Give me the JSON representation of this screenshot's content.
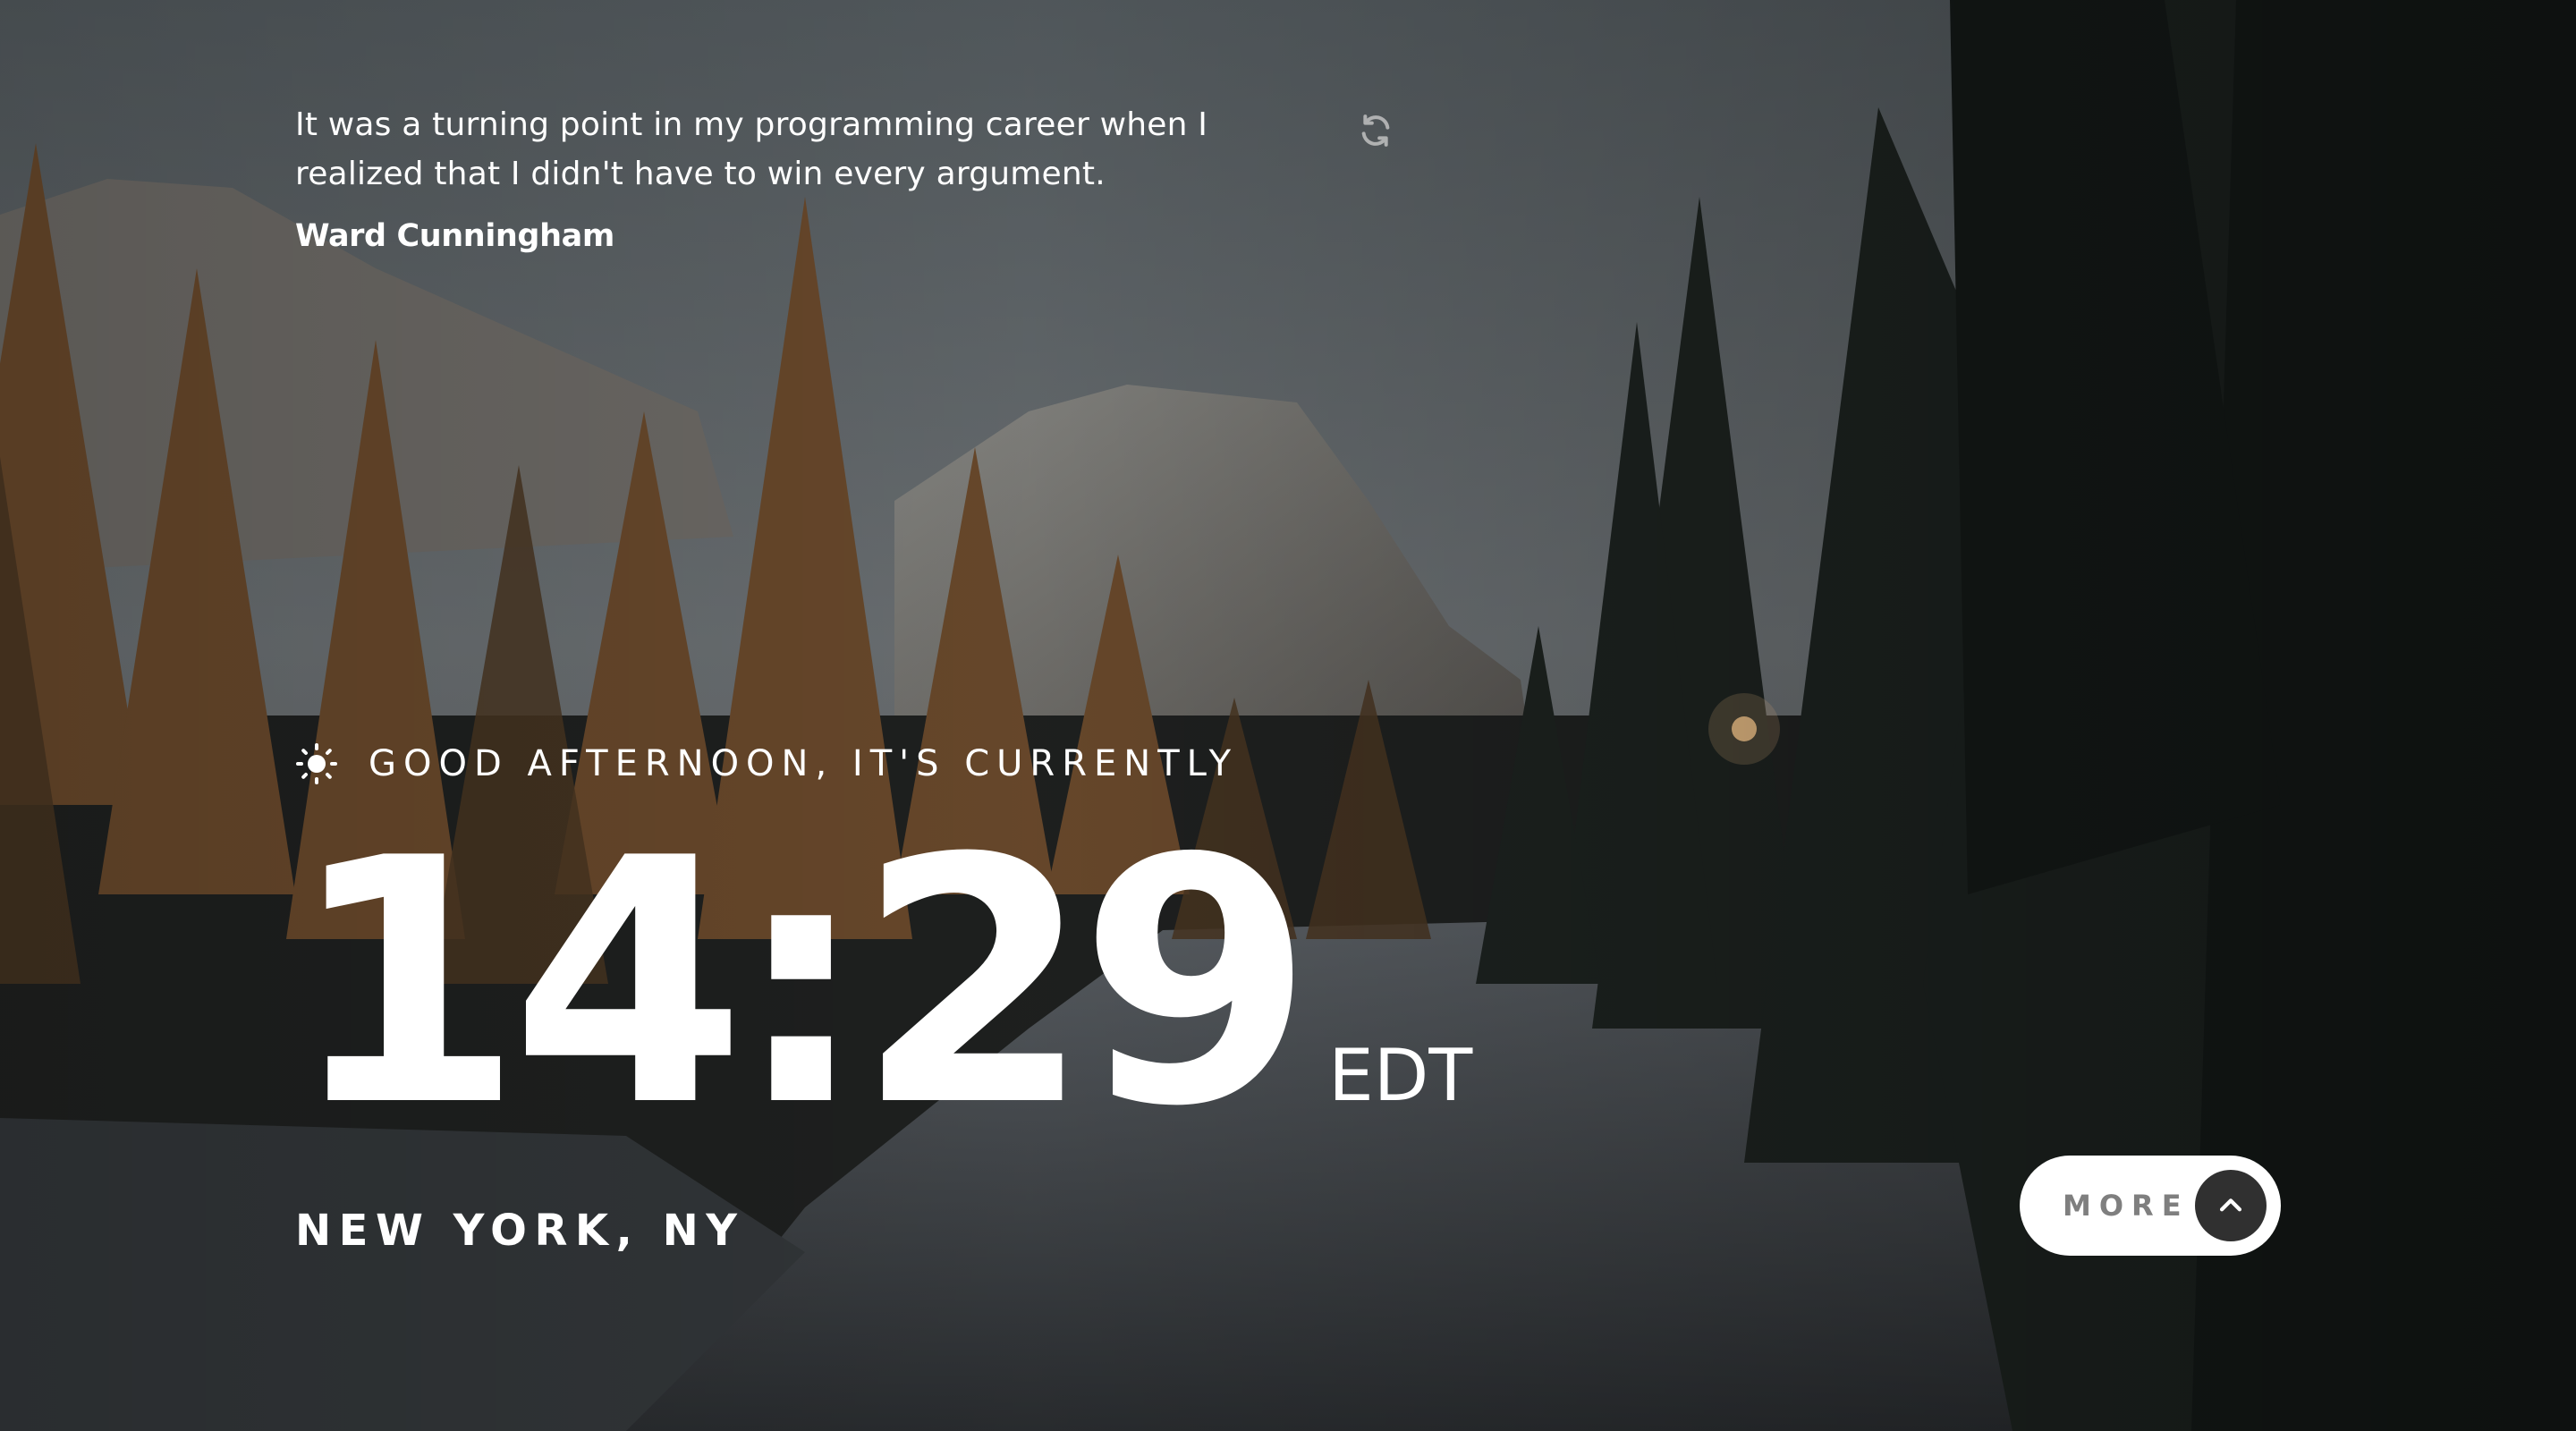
{
  "quote": {
    "text": "It was a turning point in my programming career when I realized that I didn't have to win every argument.",
    "author": "Ward Cunningham",
    "refresh_icon": "refresh-icon"
  },
  "clock": {
    "greeting": "GOOD AFTERNOON, IT'S CURRENTLY",
    "greeting_icon": "sun-icon",
    "time": "14:29",
    "timezone": "EDT",
    "location": "NEW YORK, NY"
  },
  "more_button": {
    "label": "MORE",
    "icon": "chevron-up-icon"
  },
  "colors": {
    "text": "#ffffff",
    "button_bg": "#ffffff",
    "button_label": "#7f7f7f",
    "button_arrow_bg": "#303030"
  }
}
